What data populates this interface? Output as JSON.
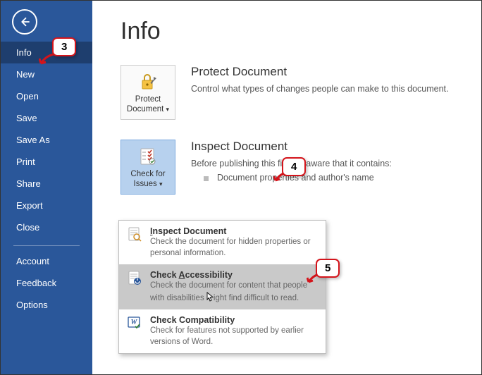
{
  "sidebar": {
    "items": [
      {
        "label": "Info",
        "active": true
      },
      {
        "label": "New"
      },
      {
        "label": "Open"
      },
      {
        "label": "Save"
      },
      {
        "label": "Save As"
      },
      {
        "label": "Print"
      },
      {
        "label": "Share"
      },
      {
        "label": "Export"
      },
      {
        "label": "Close"
      }
    ],
    "footer": [
      {
        "label": "Account"
      },
      {
        "label": "Feedback"
      },
      {
        "label": "Options"
      }
    ]
  },
  "page_title": "Info",
  "protect": {
    "tile_line1": "Protect",
    "tile_line2": "Document",
    "title": "Protect Document",
    "desc": "Control what types of changes people can make to this document."
  },
  "inspect": {
    "tile_line1": "Check for",
    "tile_line2": "Issues",
    "title": "Inspect Document",
    "desc": "Before publishing this file, be aware that it contains:",
    "bullet1": "Document properties and author's name"
  },
  "dropdown": {
    "inspect": {
      "title_pre": "I",
      "title_post": "nspect Document",
      "desc": "Check the document for hidden properties or personal information."
    },
    "accessibility": {
      "title_pre": "Check ",
      "title_key": "A",
      "title_post": "ccessibility",
      "desc_pre": "Check the document for content that people with disabilities ",
      "desc_post": "ight find difficult to read."
    },
    "compat": {
      "title": "Check Compatibility",
      "desc": "Check for features not supported by earlier versions of Word."
    }
  },
  "callouts": {
    "c3": "3",
    "c4": "4",
    "c5": "5"
  }
}
